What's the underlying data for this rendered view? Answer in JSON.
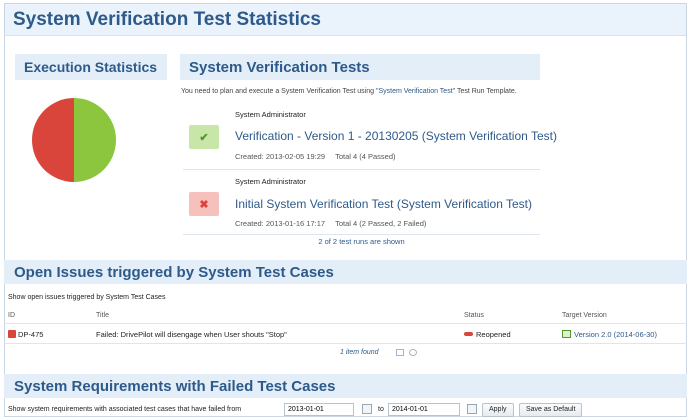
{
  "page": {
    "title": "System Verification Test Statistics"
  },
  "execution": {
    "heading": "Execution Statistics"
  },
  "svt": {
    "heading": "System Verification Tests",
    "intro_pre": "You need to plan and execute a System Verification Test using ",
    "intro_link": "\"System Verification Test\"",
    "intro_post": " Test Run Template.",
    "runs": [
      {
        "user": "System Administrator",
        "status": "passed",
        "status_glyph": "✔",
        "title": "Verification - Version 1 - 20130205 (System Verification Test)",
        "created": "Created: 2013-02-05 19:29",
        "total": "Total 4 (4 Passed)"
      },
      {
        "user": "System Administrator",
        "status": "failed",
        "status_glyph": "✖",
        "title": "Initial System Verification Test (System Verification Test)",
        "created": "Created: 2013-01-16 17:17",
        "total": "Total 4 (2 Passed, 2 Failed)"
      }
    ],
    "shown": "2 of 2 test runs are shown"
  },
  "issues": {
    "heading": "Open Issues triggered by System Test Cases",
    "subtitle": "Show open issues triggered by System Test Cases",
    "columns": {
      "id": "ID",
      "title": "Title",
      "status": "Status",
      "target": "Target Version"
    },
    "rows": [
      {
        "id": "DP-475",
        "title": "Failed: DrivePilot will disengage when User shouts \"Stop\"",
        "status": "Reopened",
        "target": "Version 2.0 (2014-06-30)"
      }
    ],
    "found": "1 item found"
  },
  "requirements": {
    "heading": "System Requirements with Failed Test Cases",
    "filter_label": "Show system requirements with associated test cases that have failed from",
    "from_date": "2013-01-01",
    "to_label": "to",
    "to_date": "2014-01-01",
    "apply_label": "Apply",
    "save_default_label": "Save as Default"
  },
  "colors": {
    "accent": "#2e5a8a",
    "passed": "#8cc63f",
    "failed": "#d9453a",
    "header_bg": "#e3eef8"
  },
  "pie": {
    "passed_fraction": 0.5,
    "failed_fraction": 0.5
  }
}
